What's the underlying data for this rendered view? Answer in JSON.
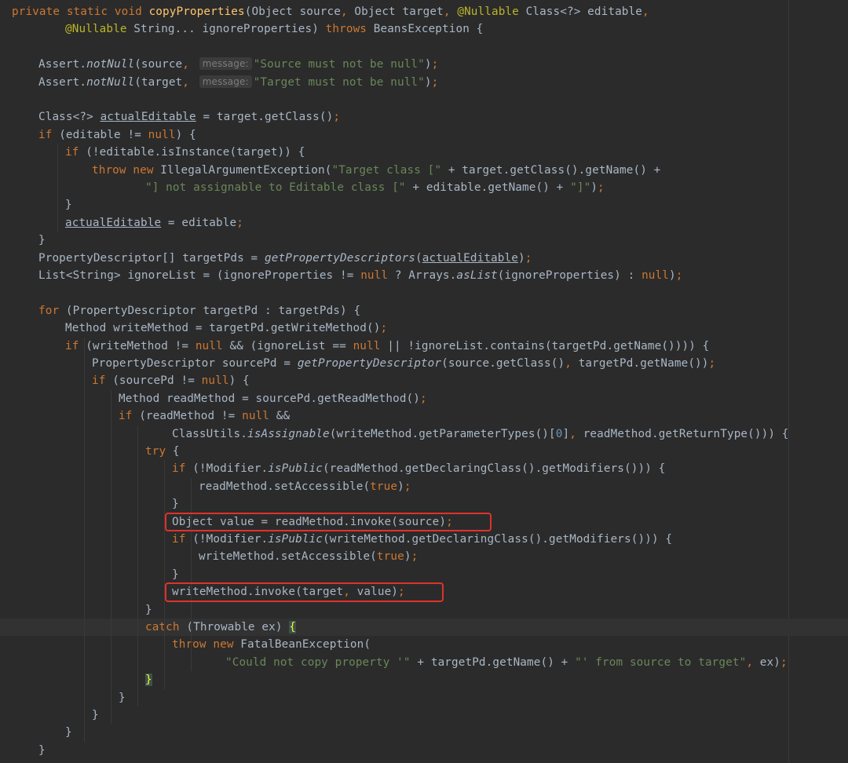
{
  "editor": {
    "lines": [
      {
        "id": "l1",
        "indent": 0,
        "tokens": [
          [
            "kw",
            "private static void "
          ],
          [
            "fn",
            "copyProperties"
          ],
          [
            "",
            "(Object source"
          ],
          [
            "punc",
            ", "
          ],
          [
            "",
            "Object target"
          ],
          [
            "punc",
            ", "
          ],
          [
            "ann",
            "@Nullable "
          ],
          [
            "",
            "Class<?> editable"
          ],
          [
            "punc",
            ","
          ]
        ]
      },
      {
        "id": "l2",
        "indent": 2,
        "tokens": [
          [
            "ann",
            "@Nullable "
          ],
          [
            "",
            "String... ignoreProperties) "
          ],
          [
            "kw",
            "throws "
          ],
          [
            "",
            "BeansException {"
          ]
        ]
      },
      {
        "id": "l3",
        "indent": 0,
        "tokens": []
      },
      {
        "id": "l4",
        "indent": 1,
        "tokens": [
          [
            "",
            "Assert."
          ],
          [
            "it",
            "notNull"
          ],
          [
            "",
            "(source"
          ],
          [
            "punc",
            ", "
          ],
          [
            "hint",
            "message:"
          ],
          [
            "str",
            "\"Source must not be null\""
          ],
          [
            "",
            ")"
          ],
          [
            "punc",
            ";"
          ]
        ]
      },
      {
        "id": "l5",
        "indent": 1,
        "tokens": [
          [
            "",
            "Assert."
          ],
          [
            "it",
            "notNull"
          ],
          [
            "",
            "(target"
          ],
          [
            "punc",
            ", "
          ],
          [
            "hint",
            "message:"
          ],
          [
            "str",
            "\"Target must not be null\""
          ],
          [
            "",
            ")"
          ],
          [
            "punc",
            ";"
          ]
        ]
      },
      {
        "id": "l6",
        "indent": 0,
        "tokens": []
      },
      {
        "id": "l7",
        "indent": 1,
        "tokens": [
          [
            "",
            "Class<?> "
          ],
          [
            "ul",
            "actualEditable"
          ],
          [
            "",
            " = target.getClass()"
          ],
          [
            "punc",
            ";"
          ]
        ]
      },
      {
        "id": "l8",
        "indent": 1,
        "tokens": [
          [
            "kw",
            "if "
          ],
          [
            "",
            "(editable != "
          ],
          [
            "kw",
            "null"
          ],
          [
            "",
            ") {"
          ]
        ]
      },
      {
        "id": "l9",
        "indent": 2,
        "tokens": [
          [
            "kw",
            "if "
          ],
          [
            "",
            "(!editable.isInstance(target)) {"
          ]
        ]
      },
      {
        "id": "l10",
        "indent": 3,
        "tokens": [
          [
            "kw",
            "throw new "
          ],
          [
            "",
            "IllegalArgumentException("
          ],
          [
            "str",
            "\"Target class [\""
          ],
          [
            "",
            " + target.getClass().getName() +"
          ]
        ]
      },
      {
        "id": "l11",
        "indent": 5,
        "tokens": [
          [
            "str",
            "\"] not assignable to Editable class [\""
          ],
          [
            "",
            " + editable.getName() + "
          ],
          [
            "str",
            "\"]\""
          ],
          [
            "",
            ")"
          ],
          [
            "punc",
            ";"
          ]
        ]
      },
      {
        "id": "l12",
        "indent": 2,
        "tokens": [
          [
            "",
            "}"
          ]
        ]
      },
      {
        "id": "l13",
        "indent": 2,
        "tokens": [
          [
            "ul",
            "actualEditable"
          ],
          [
            "",
            " = editable"
          ],
          [
            "punc",
            ";"
          ]
        ]
      },
      {
        "id": "l14",
        "indent": 1,
        "tokens": [
          [
            "",
            "}"
          ]
        ]
      },
      {
        "id": "l15",
        "indent": 1,
        "tokens": [
          [
            "",
            "PropertyDescriptor[] targetPds = "
          ],
          [
            "it",
            "getPropertyDescriptors"
          ],
          [
            "",
            "("
          ],
          [
            "ul",
            "actualEditable"
          ],
          [
            "",
            ")"
          ],
          [
            "punc",
            ";"
          ]
        ]
      },
      {
        "id": "l16",
        "indent": 1,
        "tokens": [
          [
            "",
            "List<String> ignoreList = (ignoreProperties != "
          ],
          [
            "kw",
            "null "
          ],
          [
            "",
            "? Arrays."
          ],
          [
            "it",
            "asList"
          ],
          [
            "",
            "(ignoreProperties) : "
          ],
          [
            "kw",
            "null"
          ],
          [
            "",
            ")"
          ],
          [
            "punc",
            ";"
          ]
        ]
      },
      {
        "id": "l17",
        "indent": 0,
        "tokens": []
      },
      {
        "id": "l18",
        "indent": 1,
        "tokens": [
          [
            "kw",
            "for "
          ],
          [
            "",
            "(PropertyDescriptor targetPd : targetPds) {"
          ]
        ]
      },
      {
        "id": "l19",
        "indent": 2,
        "tokens": [
          [
            "",
            "Method writeMethod = targetPd.getWriteMethod()"
          ],
          [
            "punc",
            ";"
          ]
        ]
      },
      {
        "id": "l20",
        "indent": 2,
        "tokens": [
          [
            "kw",
            "if "
          ],
          [
            "",
            "(writeMethod != "
          ],
          [
            "kw",
            "null "
          ],
          [
            "",
            "&& (ignoreList == "
          ],
          [
            "kw",
            "null "
          ],
          [
            "",
            "|| !ignoreList.contains(targetPd.getName()))) {"
          ]
        ]
      },
      {
        "id": "l21",
        "indent": 3,
        "tokens": [
          [
            "",
            "PropertyDescriptor sourcePd = "
          ],
          [
            "it",
            "getPropertyDescriptor"
          ],
          [
            "",
            "(source.getClass()"
          ],
          [
            "punc",
            ", "
          ],
          [
            "",
            "targetPd.getName())"
          ],
          [
            "punc",
            ";"
          ]
        ]
      },
      {
        "id": "l22",
        "indent": 3,
        "tokens": [
          [
            "kw",
            "if "
          ],
          [
            "",
            "(sourcePd != "
          ],
          [
            "kw",
            "null"
          ],
          [
            "",
            ") {"
          ]
        ]
      },
      {
        "id": "l23",
        "indent": 4,
        "tokens": [
          [
            "",
            "Method readMethod = sourcePd.getReadMethod()"
          ],
          [
            "punc",
            ";"
          ]
        ]
      },
      {
        "id": "l24",
        "indent": 4,
        "tokens": [
          [
            "kw",
            "if "
          ],
          [
            "",
            "(readMethod != "
          ],
          [
            "kw",
            "null "
          ],
          [
            "",
            "&&"
          ]
        ]
      },
      {
        "id": "l25",
        "indent": 6,
        "tokens": [
          [
            "",
            "ClassUtils."
          ],
          [
            "it",
            "isAssignable"
          ],
          [
            "",
            "(writeMethod.getParameterTypes()["
          ],
          [
            "num",
            "0"
          ],
          [
            "",
            "]"
          ],
          [
            "punc",
            ", "
          ],
          [
            "",
            "readMethod.getReturnType())) {"
          ]
        ]
      },
      {
        "id": "l26",
        "indent": 5,
        "tokens": [
          [
            "kw",
            "try "
          ],
          [
            "",
            "{"
          ]
        ]
      },
      {
        "id": "l27",
        "indent": 6,
        "tokens": [
          [
            "kw",
            "if "
          ],
          [
            "",
            "(!Modifier."
          ],
          [
            "it",
            "isPublic"
          ],
          [
            "",
            "(readMethod.getDeclaringClass().getModifiers())) {"
          ]
        ]
      },
      {
        "id": "l28",
        "indent": 7,
        "tokens": [
          [
            "",
            "readMethod.setAccessible("
          ],
          [
            "kw",
            "true"
          ],
          [
            "",
            ")"
          ],
          [
            "punc",
            ";"
          ]
        ]
      },
      {
        "id": "l29",
        "indent": 6,
        "tokens": [
          [
            "",
            "}"
          ]
        ]
      },
      {
        "id": "l30",
        "indent": 6,
        "tokens": [
          [
            "",
            "Object value = readMethod.invoke(source)"
          ],
          [
            "punc",
            ";"
          ]
        ]
      },
      {
        "id": "l31",
        "indent": 6,
        "tokens": [
          [
            "kw",
            "if "
          ],
          [
            "",
            "(!Modifier."
          ],
          [
            "it",
            "isPublic"
          ],
          [
            "",
            "(writeMethod.getDeclaringClass().getModifiers())) {"
          ]
        ]
      },
      {
        "id": "l32",
        "indent": 7,
        "tokens": [
          [
            "",
            "writeMethod.setAccessible("
          ],
          [
            "kw",
            "true"
          ],
          [
            "",
            ")"
          ],
          [
            "punc",
            ";"
          ]
        ]
      },
      {
        "id": "l33",
        "indent": 6,
        "tokens": [
          [
            "",
            "}"
          ]
        ]
      },
      {
        "id": "l34",
        "indent": 6,
        "tokens": [
          [
            "",
            "writeMethod.invoke(target"
          ],
          [
            "punc",
            ", "
          ],
          [
            "",
            "value)"
          ],
          [
            "punc",
            ";"
          ]
        ]
      },
      {
        "id": "l35",
        "indent": 5,
        "tokens": [
          [
            "",
            "}"
          ]
        ]
      },
      {
        "id": "l36",
        "indent": 5,
        "current": true,
        "tokens": [
          [
            "kw",
            "catch "
          ],
          [
            "",
            "(Throwable ex) "
          ],
          [
            "brace",
            "{"
          ]
        ]
      },
      {
        "id": "l37",
        "indent": 6,
        "tokens": [
          [
            "kw",
            "throw new "
          ],
          [
            "",
            "FatalBeanException("
          ]
        ]
      },
      {
        "id": "l38",
        "indent": 8,
        "tokens": [
          [
            "str",
            "\"Could not copy property '\""
          ],
          [
            "",
            " + targetPd.getName() + "
          ],
          [
            "str",
            "\"' from source to target\""
          ],
          [
            "punc",
            ", "
          ],
          [
            "",
            "ex)"
          ],
          [
            "punc",
            ";"
          ]
        ]
      },
      {
        "id": "l39",
        "indent": 5,
        "tokens": [
          [
            "brace",
            "}"
          ]
        ]
      },
      {
        "id": "l40",
        "indent": 4,
        "tokens": [
          [
            "",
            "}"
          ]
        ]
      },
      {
        "id": "l41",
        "indent": 3,
        "tokens": [
          [
            "",
            "}"
          ]
        ]
      },
      {
        "id": "l42",
        "indent": 2,
        "tokens": [
          [
            "",
            "}"
          ]
        ]
      },
      {
        "id": "l43",
        "indent": 1,
        "tokens": [
          [
            "",
            "}"
          ]
        ]
      }
    ],
    "highlights": [
      "l30",
      "l34"
    ]
  },
  "colors": {
    "background": "#2b2b2b",
    "keyword": "#cc7832",
    "method_decl": "#ffc66d",
    "string": "#6a8759",
    "annotation": "#bbb529",
    "default_text": "#a9b7c6",
    "number": "#6897bb",
    "highlight_box": "#e0322c"
  }
}
